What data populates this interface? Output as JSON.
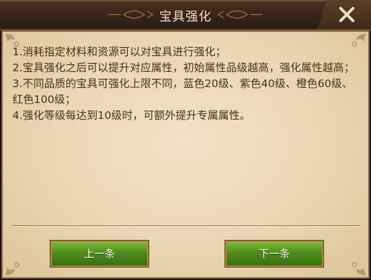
{
  "dialog": {
    "title": "宝具强化",
    "close_icon": "close-icon"
  },
  "rules": [
    "1.消耗指定材料和资源可以对宝具进行强化；",
    "2.宝具强化之后可以提升对应属性，初始属性品级越高，强化属性越高；",
    "3.不同品质的宝具可强化上限不同，蓝色20级、紫色40级、橙色60级、红色100级；",
    "4.强化等级每达到10级时，可额外提升专属属性。"
  ],
  "buttons": {
    "prev_label": "上一条",
    "next_label": "下一条"
  },
  "colors": {
    "parchment": "#ecdbbb",
    "text": "#4b2f18",
    "button_green": "#4f8d1c",
    "title_bar": "#36241a"
  }
}
